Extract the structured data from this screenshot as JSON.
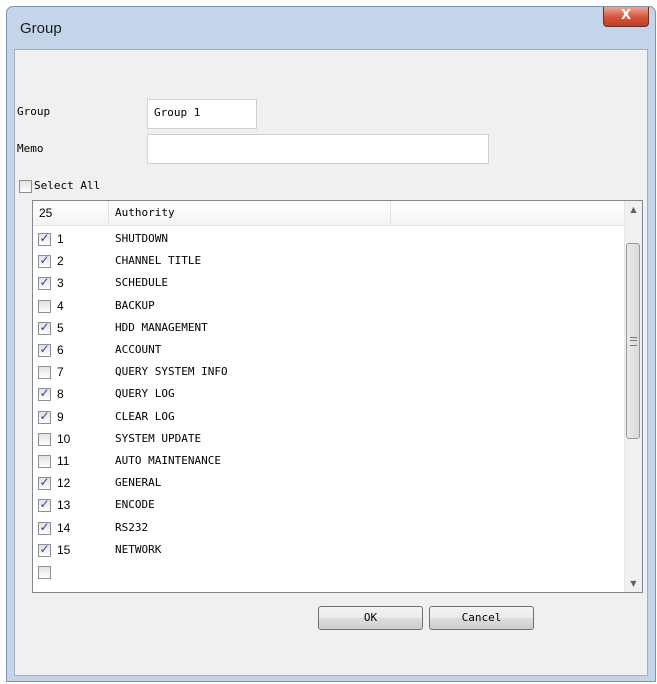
{
  "window": {
    "title": "Group",
    "close_glyph": "X"
  },
  "form": {
    "group_label": "Group",
    "group_value": "Group 1",
    "memo_label": "Memo",
    "memo_value": "",
    "select_all_label": "Select All",
    "select_all_checked": false
  },
  "list": {
    "header_count": "25",
    "header_authority": "Authority",
    "rows": [
      {
        "num": "1",
        "name": "SHUTDOWN",
        "checked": true
      },
      {
        "num": "2",
        "name": "CHANNEL TITLE",
        "checked": true
      },
      {
        "num": "3",
        "name": "SCHEDULE",
        "checked": true
      },
      {
        "num": "4",
        "name": "BACKUP",
        "checked": false
      },
      {
        "num": "5",
        "name": "HDD MANAGEMENT",
        "checked": true
      },
      {
        "num": "6",
        "name": "ACCOUNT",
        "checked": true
      },
      {
        "num": "7",
        "name": "QUERY SYSTEM INFO",
        "checked": false
      },
      {
        "num": "8",
        "name": "QUERY LOG",
        "checked": true
      },
      {
        "num": "9",
        "name": "CLEAR LOG",
        "checked": true
      },
      {
        "num": "10",
        "name": "SYSTEM UPDATE",
        "checked": false
      },
      {
        "num": "11",
        "name": "AUTO MAINTENANCE",
        "checked": false
      },
      {
        "num": "12",
        "name": "GENERAL",
        "checked": true
      },
      {
        "num": "13",
        "name": "ENCODE",
        "checked": true
      },
      {
        "num": "14",
        "name": "RS232",
        "checked": true
      },
      {
        "num": "15",
        "name": "NETWORK",
        "checked": true
      }
    ]
  },
  "buttons": {
    "ok": "OK",
    "cancel": "Cancel"
  },
  "icons": {
    "close": "close-icon",
    "scroll_up": "chevron-up-icon",
    "scroll_down": "chevron-down-icon",
    "check": "checkmark-icon"
  },
  "colors": {
    "window_frame": "#c4d5e9",
    "close_button": "#d2553b",
    "checkmark": "#2c3e9e"
  }
}
